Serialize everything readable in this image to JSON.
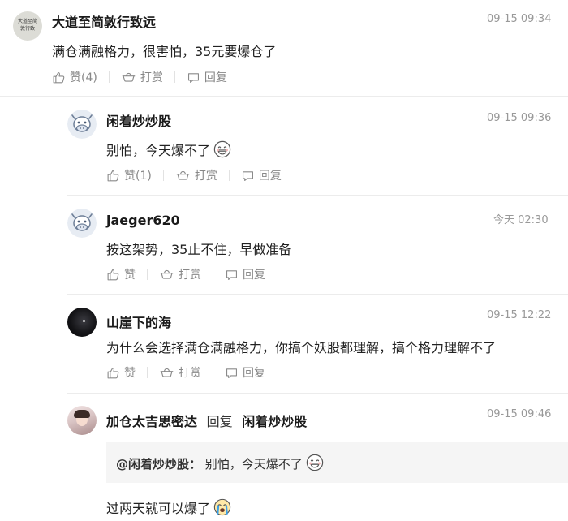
{
  "top_comment": {
    "author": "大道至简敦行致远",
    "avatar_text": "大道至简 敦行致",
    "time": "09-15 09:34",
    "text": "满仓满融格力，很害怕，35元要爆仓了",
    "like_label": "赞(4)",
    "reward_label": "打赏",
    "reply_label": "回复"
  },
  "replies": [
    {
      "author": "闲着炒炒股",
      "time": "09-15 09:36",
      "text": "别怕，今天爆不了",
      "like_label": "赞(1)",
      "reward_label": "打赏",
      "reply_label": "回复"
    },
    {
      "author": "jaeger620",
      "time": "今天 02:30",
      "text": "按这架势，35止不住，早做准备",
      "like_label": "赞",
      "reward_label": "打赏",
      "reply_label": "回复"
    },
    {
      "author": "山崖下的海",
      "time": "09-15 12:22",
      "text": "为什么会选择满仓满融格力，你搞个妖股都理解，搞个格力理解不了",
      "like_label": "赞",
      "reward_label": "打赏",
      "reply_label": "回复"
    },
    {
      "author": "加仓太吉思密达",
      "reply_word": "回复",
      "reply_to": "闲着炒炒股",
      "time": "09-15 09:46",
      "quote_name": "@闲着炒炒股：",
      "quote_text": "别怕，今天爆不了",
      "text": "过两天就可以爆了"
    }
  ],
  "icons": {
    "like": "thumbs-up-icon",
    "reward": "ingot-icon",
    "reply": "speech-bubble-icon",
    "smile": "grinning-face-emoji",
    "cry": "crying-face-emoji"
  },
  "colors": {
    "meta_text": "#888888",
    "divider": "#ececec",
    "quote_bg": "#f5f5f5"
  }
}
